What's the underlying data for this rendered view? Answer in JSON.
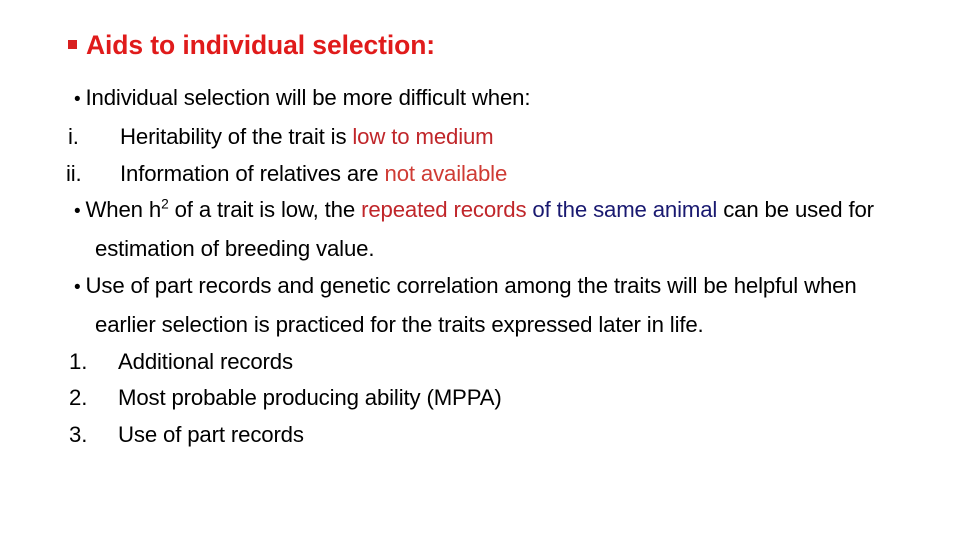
{
  "slide": {
    "background_color": "#ffffff",
    "title": {
      "bullet_icon": "square-bullet-icon",
      "text": "Aids to individual selection:",
      "color": "#e01b1b"
    },
    "colors": {
      "title_red": "#e01b1b",
      "highlight_red": "#c0262a",
      "highlight_red_soft": "#cf3b34",
      "navy": "#191970",
      "body_black": "#000000"
    },
    "body": [
      {
        "kind": "bullet",
        "bullet": "•",
        "segments": [
          {
            "text": "Individual selection will be more difficult when:",
            "color": "black"
          }
        ]
      },
      {
        "kind": "roman",
        "marker": "i.",
        "segments": [
          {
            "text": "Heritability of the trait is ",
            "color": "black"
          },
          {
            "text": "low to medium",
            "color": "red"
          }
        ]
      },
      {
        "kind": "roman",
        "marker": "ii.",
        "segments": [
          {
            "text": "Information of relatives are ",
            "color": "black"
          },
          {
            "text": "not available",
            "color": "red-soft"
          }
        ]
      },
      {
        "kind": "bullet",
        "bullet": "•",
        "segments": [
          {
            "text": "When h",
            "color": "black"
          },
          {
            "text": "2",
            "color": "black",
            "sup": true
          },
          {
            "text": " of a trait is low, the ",
            "color": "black"
          },
          {
            "text": "repeated records",
            "color": "red"
          },
          {
            "text": " of the same animal",
            "color": "navy"
          },
          {
            "text": " can be used for estimation of breeding value.",
            "color": "black"
          }
        ]
      },
      {
        "kind": "bullet",
        "bullet": "•",
        "segments": [
          {
            "text": "Use of part records and genetic correlation among the traits will be helpful when earlier selection is practiced for the traits expressed later in life.",
            "color": "black"
          }
        ]
      },
      {
        "kind": "number",
        "marker": "1.",
        "segments": [
          {
            "text": "Additional records",
            "color": "black"
          }
        ]
      },
      {
        "kind": "number",
        "marker": "2.",
        "segments": [
          {
            "text": "Most probable producing ability (MPPA)",
            "color": "black"
          }
        ]
      },
      {
        "kind": "number",
        "marker": "3.",
        "segments": [
          {
            "text": "Use of part records",
            "color": "black"
          }
        ]
      }
    ]
  }
}
